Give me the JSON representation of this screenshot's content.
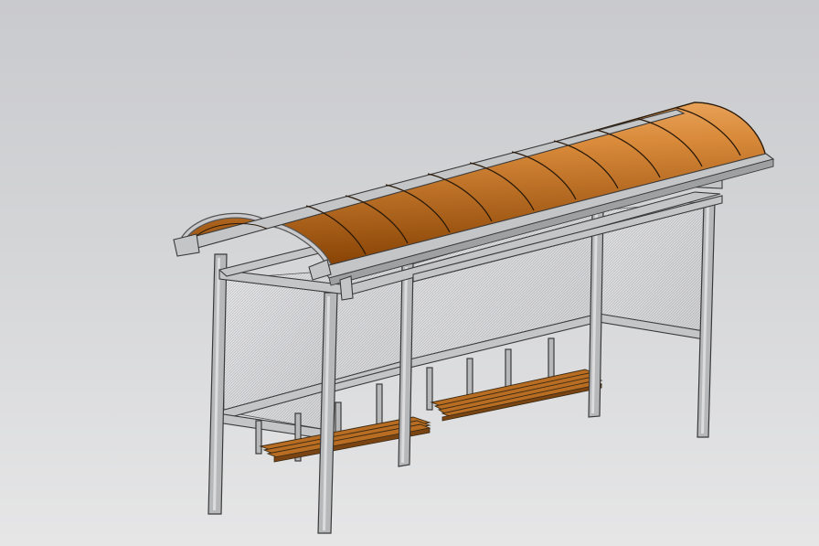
{
  "scene": {
    "background_top": "#c9cacd",
    "background_bottom": "#e6e6e7",
    "roof_color_light": "#d98a3a",
    "roof_color_dark": "#8a4506",
    "frame_color": "#b7b8ba",
    "bench_wood_color": "#b86d22",
    "roof_rib_count": 10,
    "bench_count": 2
  }
}
